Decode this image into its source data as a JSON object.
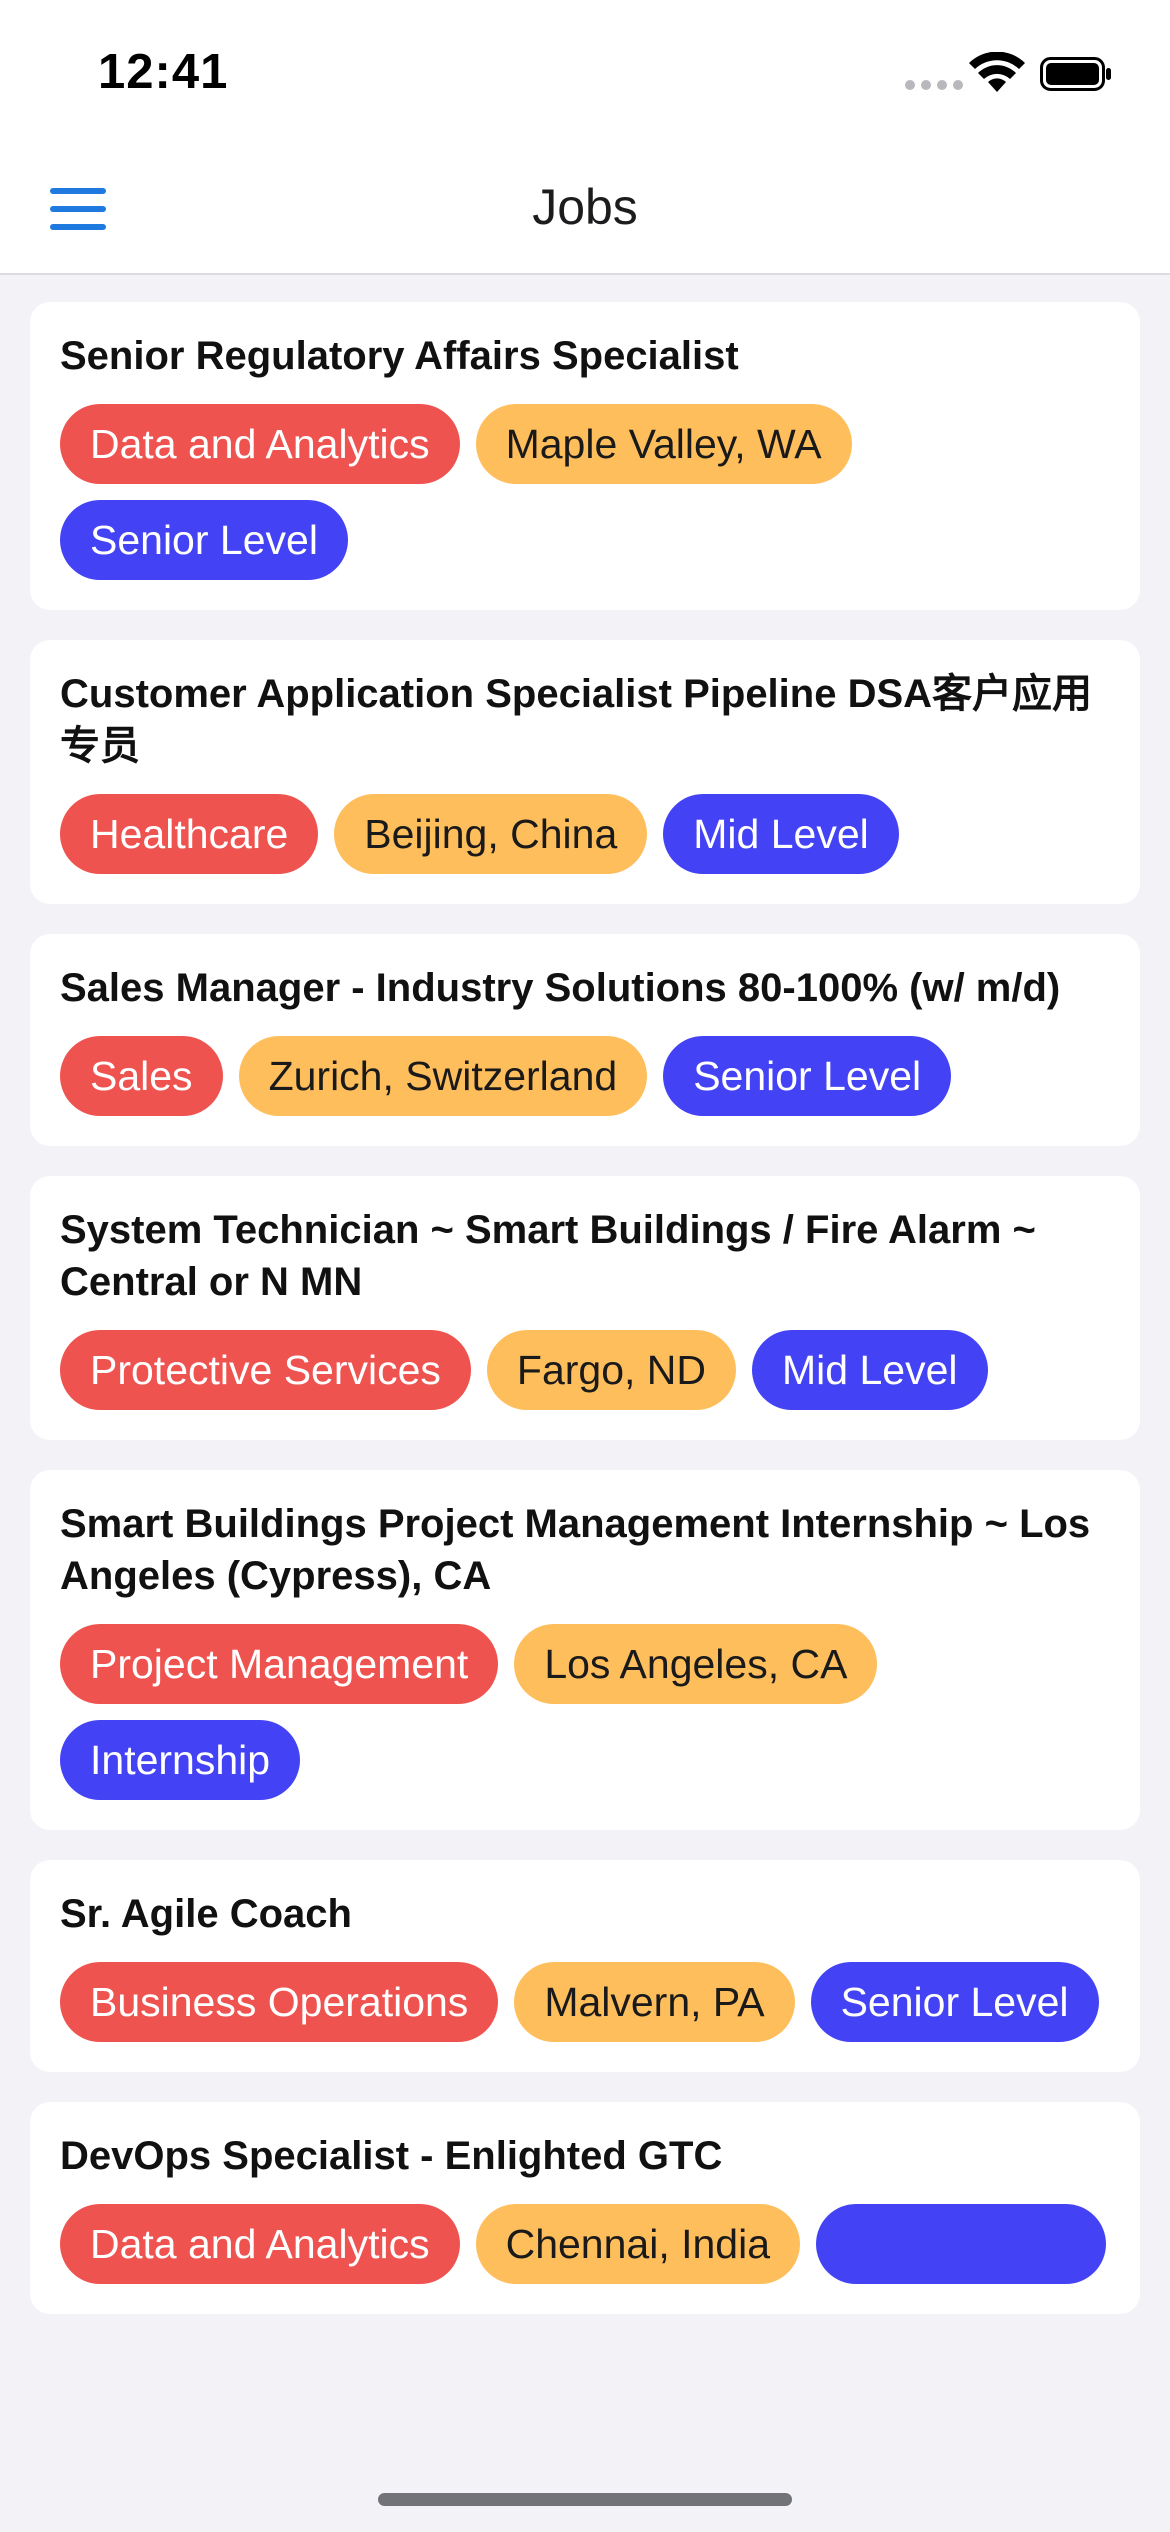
{
  "status_bar": {
    "time": "12:41",
    "wifi_icon": "wifi-icon",
    "battery_icon": "battery-icon",
    "signal_icon": "cellular-signal-icon"
  },
  "nav": {
    "title": "Jobs",
    "menu_icon": "hamburger-menu-icon"
  },
  "colors": {
    "category_tag": "#ef5350",
    "location_tag": "#ffbe5c",
    "level_tag": "#4343f5",
    "accent": "#1f7ae0"
  },
  "jobs": [
    {
      "title": "Senior Regulatory Affairs Specialist",
      "category": "Data and Analytics",
      "location": "Maple Valley, WA",
      "level": "Senior Level"
    },
    {
      "title": "Customer Application Specialist Pipeline DSA客户应用专员",
      "category": "Healthcare",
      "location": "Beijing, China",
      "level": "Mid Level"
    },
    {
      "title": "Sales Manager - Industry Solutions 80-100% (w/ m/d)",
      "category": "Sales",
      "location": "Zurich, Switzerland",
      "level": "Senior Level"
    },
    {
      "title": "System Technician ~ Smart Buildings / Fire Alarm ~ Central or N MN",
      "category": "Protective Services",
      "location": "Fargo, ND",
      "level": "Mid Level"
    },
    {
      "title": "Smart Buildings Project Management Internship ~ Los Angeles (Cypress), CA",
      "category": "Project Management",
      "location": "Los Angeles, CA",
      "level": "Internship"
    },
    {
      "title": "Sr. Agile Coach",
      "category": "Business Operations",
      "location": "Malvern, PA",
      "level": "Senior Level"
    },
    {
      "title": "DevOps Specialist  - Enlighted  GTC",
      "category": "Data and Analytics",
      "location": "Chennai, India",
      "level": ""
    }
  ]
}
